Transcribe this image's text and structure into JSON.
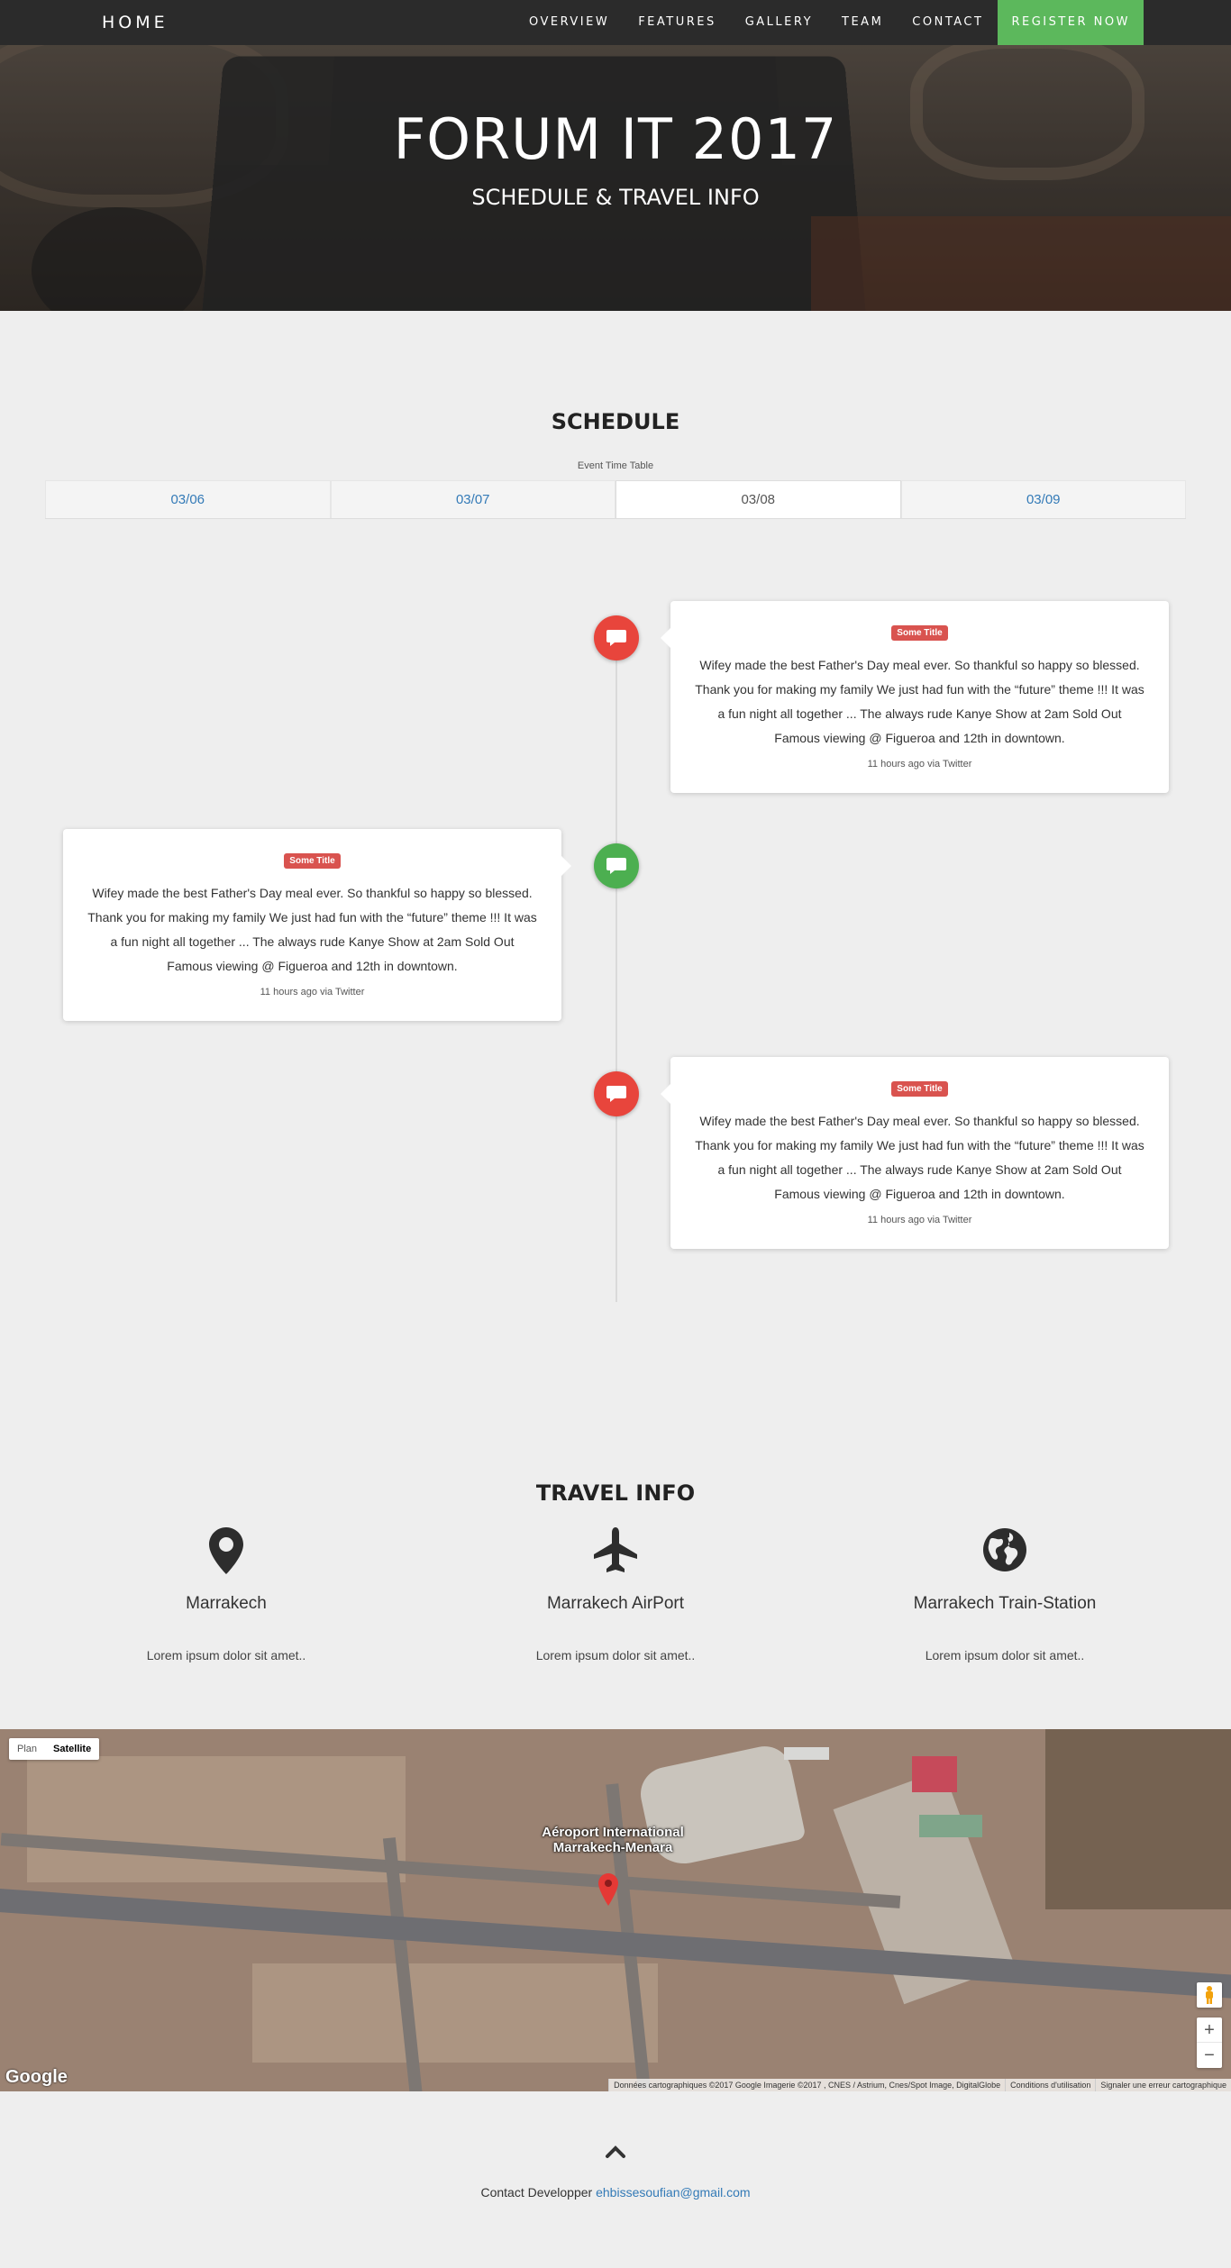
{
  "nav": {
    "brand": "HOME",
    "items": [
      "OVERVIEW",
      "FEATURES",
      "GALLERY",
      "TEAM",
      "CONTACT"
    ],
    "register": "REGISTER NOW",
    "register_color": "#5cb85c"
  },
  "hero": {
    "title": "FORUM IT 2017",
    "subtitle": "SCHEDULE & TRAVEL INFO"
  },
  "schedule": {
    "title": "SCHEDULE",
    "subtitle": "Event Time Table",
    "tabs": [
      "03/06",
      "03/07",
      "03/08",
      "03/09"
    ],
    "active_tab": "03/08",
    "events": [
      {
        "side": "right",
        "icon": "comment-icon",
        "icon_color": "#e8453c",
        "badge": "Some Title",
        "text": "Wifey made the best Father's Day meal ever. So thankful so happy so blessed. Thank you for making my family We just had fun with the “future” theme !!! It was a fun night all together ... The always rude Kanye Show at 2am Sold Out Famous viewing @ Figueroa and 12th in downtown.",
        "meta": "11 hours ago via Twitter"
      },
      {
        "side": "left",
        "icon": "comment-icon",
        "icon_color": "#4caf50",
        "badge": "Some Title",
        "text": "Wifey made the best Father's Day meal ever. So thankful so happy so blessed. Thank you for making my family We just had fun with the “future” theme !!! It was a fun night all together ... The always rude Kanye Show at 2am Sold Out Famous viewing @ Figueroa and 12th in downtown.",
        "meta": "11 hours ago via Twitter"
      },
      {
        "side": "right",
        "icon": "comment-icon",
        "icon_color": "#e8453c",
        "badge": "Some Title",
        "text": "Wifey made the best Father's Day meal ever. So thankful so happy so blessed. Thank you for making my family We just had fun with the “future” theme !!! It was a fun night all together ... The always rude Kanye Show at 2am Sold Out Famous viewing @ Figueroa and 12th in downtown.",
        "meta": "11 hours ago via Twitter"
      }
    ]
  },
  "travel": {
    "title": "TRAVEL INFO",
    "items": [
      {
        "icon": "map-marker-icon",
        "place": "Marrakech",
        "desc": "Lorem ipsum dolor sit amet.."
      },
      {
        "icon": "plane-icon",
        "place": "Marrakech AirPort",
        "desc": "Lorem ipsum dolor sit amet.."
      },
      {
        "icon": "globe-icon",
        "place": "Marrakech Train-Station",
        "desc": "Lorem ipsum dolor sit amet.."
      }
    ]
  },
  "map": {
    "type_options": [
      "Plan",
      "Satellite"
    ],
    "selected_type": "Satellite",
    "marker_label": "Aéroport International Marrakech-Menara",
    "logo": "Google",
    "attribution": [
      "Données cartographiques ©2017 Google Imagerie ©2017 , CNES / Astrium, Cnes/Spot Image, DigitalGlobe",
      "Conditions d'utilisation",
      "Signaler une erreur cartographique"
    ],
    "zoom_in": "+",
    "zoom_out": "−"
  },
  "footer": {
    "label": "Contact Developper",
    "email": "ehbissesoufian@gmail.com"
  }
}
